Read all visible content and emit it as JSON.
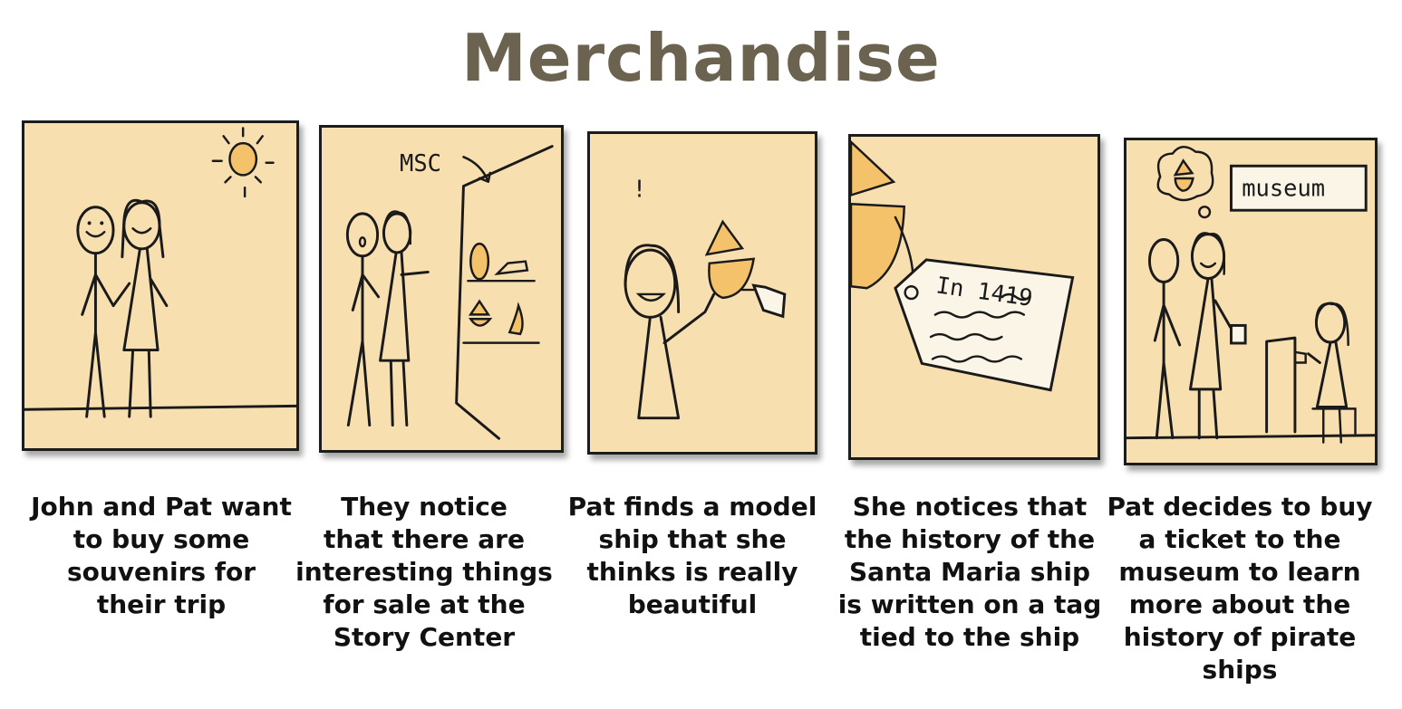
{
  "title": "Merchandise",
  "panels": [
    {
      "caption": "John and Pat want\nto buy some\nsouvenirs for\ntheir trip"
    },
    {
      "caption": "They notice\nthat there are\ninteresting things\nfor sale at the\nStory Center",
      "sign": "MSC"
    },
    {
      "caption": "Pat finds a model\nship that she\nthinks is really\nbeautiful",
      "exclaim": "!"
    },
    {
      "caption": "She notices that\nthe history of the\nSanta Maria ship\nis written on a tag\ntied to the ship",
      "tag_text": "In 1419"
    },
    {
      "caption": "Pat decides to buy\na ticket to the\nmuseum to learn\nmore about the\nhistory of pirate\nships",
      "sign": "museum"
    }
  ],
  "colors": {
    "panel_bg": "#f7dfb0",
    "accent": "#f3c26a",
    "title": "#6b6350"
  }
}
